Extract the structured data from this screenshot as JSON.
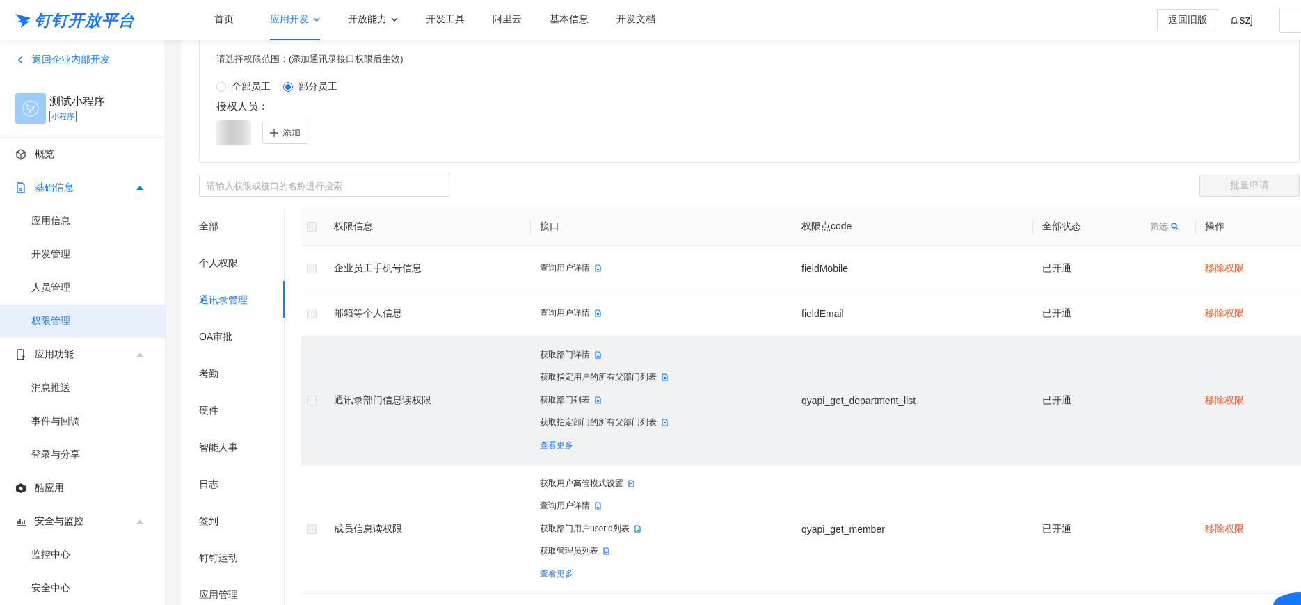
{
  "header": {
    "logo": "钉钉开放平台",
    "nav": [
      {
        "label": "首页",
        "selected": false,
        "dropdown": false
      },
      {
        "label": "应用开发",
        "selected": true,
        "dropdown": true
      },
      {
        "label": "开放能力",
        "selected": false,
        "dropdown": true
      },
      {
        "label": "开发工具",
        "selected": false,
        "dropdown": false
      },
      {
        "label": "阿里云",
        "selected": false,
        "dropdown": false
      },
      {
        "label": "基本信息",
        "selected": false,
        "dropdown": false
      },
      {
        "label": "开发文档",
        "selected": false,
        "dropdown": false
      }
    ],
    "old_version_button": "返回旧版",
    "user": "szj"
  },
  "sidebar": {
    "back_link": "返回企业内部开发",
    "app": {
      "name": "测试小程序",
      "tag": "小程序"
    },
    "items": [
      {
        "label": "概览"
      },
      {
        "label": "基础信息",
        "expanded": true,
        "children": [
          {
            "label": "应用信息",
            "selected": false
          },
          {
            "label": "开发管理",
            "selected": false
          },
          {
            "label": "人员管理",
            "selected": false
          },
          {
            "label": "权限管理",
            "selected": true
          }
        ]
      },
      {
        "label": "应用功能",
        "expanded": true,
        "children": [
          {
            "label": "消息推送",
            "selected": false
          },
          {
            "label": "事件与回调",
            "selected": false
          },
          {
            "label": "登录与分享",
            "selected": false
          }
        ]
      },
      {
        "label": "酷应用"
      },
      {
        "label": "安全与监控",
        "expanded": true,
        "children": [
          {
            "label": "监控中心",
            "selected": false
          },
          {
            "label": "安全中心",
            "selected": false
          }
        ]
      }
    ]
  },
  "scope": {
    "title": "请选择权限范围：(添加通讯录接口权限后生效)",
    "options": [
      {
        "label": "全部员工",
        "selected": false
      },
      {
        "label": "部分员工",
        "selected": true
      }
    ],
    "authorized_label": "授权人员：",
    "add_button": "添加"
  },
  "search": {
    "placeholder": "请输入权限或接口的名称进行搜索"
  },
  "batch_button": {
    "label": "批量申请",
    "disabled": true
  },
  "categories": [
    {
      "label": "全部",
      "selected": false
    },
    {
      "label": "个人权限",
      "selected": false
    },
    {
      "label": "通讯录管理",
      "selected": true
    },
    {
      "label": "OA审批",
      "selected": false
    },
    {
      "label": "考勤",
      "selected": false
    },
    {
      "label": "硬件",
      "selected": false
    },
    {
      "label": "智能人事",
      "selected": false
    },
    {
      "label": "日志",
      "selected": false
    },
    {
      "label": "签到",
      "selected": false
    },
    {
      "label": "钉钉运动",
      "selected": false
    },
    {
      "label": "应用管理",
      "selected": false
    }
  ],
  "table": {
    "select_all_checked": false,
    "columns": [
      {
        "label": "权限信息"
      },
      {
        "label": "接口"
      },
      {
        "label": "权限点code"
      },
      {
        "label": "全部状态",
        "filter": "筛选"
      },
      {
        "label": "操作"
      }
    ],
    "rows": [
      {
        "checked": false,
        "hovered": false,
        "name": "企业员工手机号信息",
        "apis": [
          "查询用户详情"
        ],
        "code": "fieldMobile",
        "status": "已开通",
        "action": "移除权限"
      },
      {
        "checked": false,
        "hovered": false,
        "name": "邮箱等个人信息",
        "apis": [
          "查询用户详情"
        ],
        "code": "fieldEmail",
        "status": "已开通",
        "action": "移除权限"
      },
      {
        "checked": false,
        "hovered": true,
        "name": "通讯录部门信息读权限",
        "apis": [
          "获取部门详情",
          "获取指定用户的所有父部门列表",
          "获取部门列表",
          "获取指定部门的所有父部门列表"
        ],
        "more": "查看更多",
        "code": "qyapi_get_department_list",
        "status": "已开通",
        "action": "移除权限"
      },
      {
        "checked": false,
        "hovered": false,
        "name": "成员信息读权限",
        "apis": [
          "获取用户高管模式设置",
          "查询用户详情",
          "获取部门用户userid列表",
          "获取管理员列表"
        ],
        "more": "查看更多",
        "code": "qyapi_get_member",
        "status": "已开通",
        "action": "移除权限"
      }
    ]
  }
}
